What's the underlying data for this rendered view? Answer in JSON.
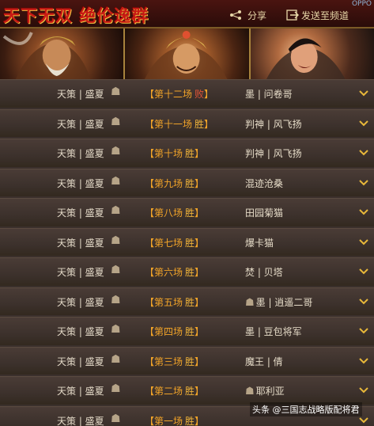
{
  "header": {
    "title": "天下无双 绝伦逸群",
    "share_label": "分享",
    "send_label": "发送至频道",
    "corner_tag": "OPPO"
  },
  "portraits": [
    {
      "name": "portrait-left"
    },
    {
      "name": "portrait-center"
    },
    {
      "name": "portrait-right"
    }
  ],
  "rows": [
    {
      "server": "天策 | 盛夏",
      "match": "第十二场",
      "result": "败",
      "opponent": "墨 | 问卷哥",
      "opp_emblem": false
    },
    {
      "server": "天策 | 盛夏",
      "match": "第十一场",
      "result": "胜",
      "opponent": "判神 | 风飞扬",
      "opp_emblem": false
    },
    {
      "server": "天策 | 盛夏",
      "match": "第十场",
      "result": "胜",
      "opponent": "判神 | 风飞扬",
      "opp_emblem": false
    },
    {
      "server": "天策 | 盛夏",
      "match": "第九场",
      "result": "胜",
      "opponent": "混迹沧桑",
      "opp_emblem": false
    },
    {
      "server": "天策 | 盛夏",
      "match": "第八场",
      "result": "胜",
      "opponent": "田园菊猫",
      "opp_emblem": false
    },
    {
      "server": "天策 | 盛夏",
      "match": "第七场",
      "result": "胜",
      "opponent": "爆卡猫",
      "opp_emblem": false
    },
    {
      "server": "天策 | 盛夏",
      "match": "第六场",
      "result": "胜",
      "opponent": "焚 | 贝塔",
      "opp_emblem": false
    },
    {
      "server": "天策 | 盛夏",
      "match": "第五场",
      "result": "胜",
      "opponent": "墨 | 逍遥二哥",
      "opp_emblem": true
    },
    {
      "server": "天策 | 盛夏",
      "match": "第四场",
      "result": "胜",
      "opponent": "墨 | 豆包将军",
      "opp_emblem": false
    },
    {
      "server": "天策 | 盛夏",
      "match": "第三场",
      "result": "胜",
      "opponent": "魔王 | 倩",
      "opp_emblem": false
    },
    {
      "server": "天策 | 盛夏",
      "match": "第二场",
      "result": "胜",
      "opponent": "耶利亚",
      "opp_emblem": true
    },
    {
      "server": "天策 | 盛夏",
      "match": "第一场",
      "result": "胜",
      "opponent": "",
      "opp_emblem": false
    }
  ],
  "watermark": "头条 @三国志战略版配将君",
  "colors": {
    "win": "#f0b43a",
    "lose": "#e05436",
    "header_red": "#c81a14"
  }
}
